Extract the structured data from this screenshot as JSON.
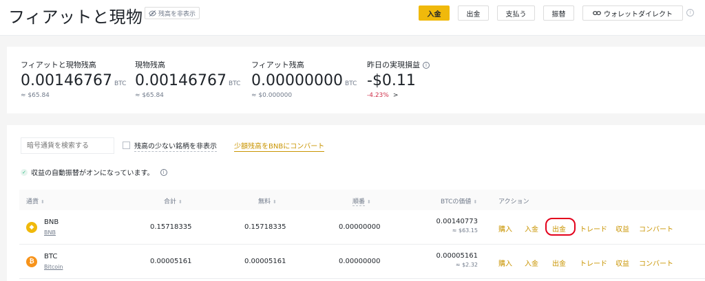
{
  "header": {
    "title": "フィアットと現物",
    "hide_balance_label": "残高を非表示",
    "buttons": {
      "deposit": "入金",
      "withdraw": "出金",
      "pay": "支払う",
      "transfer": "振替",
      "wallet_direct": "ウォレットダイレクト"
    }
  },
  "summary": {
    "total": {
      "label": "フィアットと現物残高",
      "value": "0.00146767",
      "unit": "BTC",
      "fiat": "≈ $65.84"
    },
    "spot": {
      "label": "現物残高",
      "value": "0.00146767",
      "unit": "BTC",
      "fiat": "≈ $65.84"
    },
    "fiat": {
      "label": "フィアット残高",
      "value": "0.00000000",
      "unit": "BTC",
      "fiat": "≈ $0.000000"
    },
    "pnl": {
      "label": "昨日の実現損益",
      "value": "-$0.11",
      "change": "-4.23%",
      "arrow": ">"
    }
  },
  "toolbar": {
    "search_placeholder": "暗号通貨を検索する",
    "hide_small_label": "残高の少ない銘柄を非表示",
    "convert_link": "少額残高をBNBにコンバート",
    "auto_transfer_note": "収益の自動振替がオンになっています。",
    "info_glyph": "i"
  },
  "table": {
    "headers": {
      "coin": "通貨",
      "total": "合計",
      "available": "無料",
      "in_order": "順番",
      "btc_value": "BTCの価値",
      "action": "アクション"
    },
    "rows": [
      {
        "symbol": "BNB",
        "name": "BNB",
        "total": "0.15718335",
        "available": "0.15718335",
        "in_order": "0.00000000",
        "btc_value": "0.00140773",
        "usd": "≈ $63.15",
        "icon_color": "#f0b90b"
      },
      {
        "symbol": "BTC",
        "name": "Bitcoin",
        "total": "0.00005161",
        "available": "0.00005161",
        "in_order": "0.00000000",
        "btc_value": "0.00005161",
        "usd": "≈ $2.32",
        "icon_color": "#f7931a"
      }
    ],
    "actions": {
      "buy": "購入",
      "deposit": "入金",
      "withdraw": "出金",
      "trade": "トレード",
      "earn": "収益",
      "convert": "コンバート"
    }
  }
}
